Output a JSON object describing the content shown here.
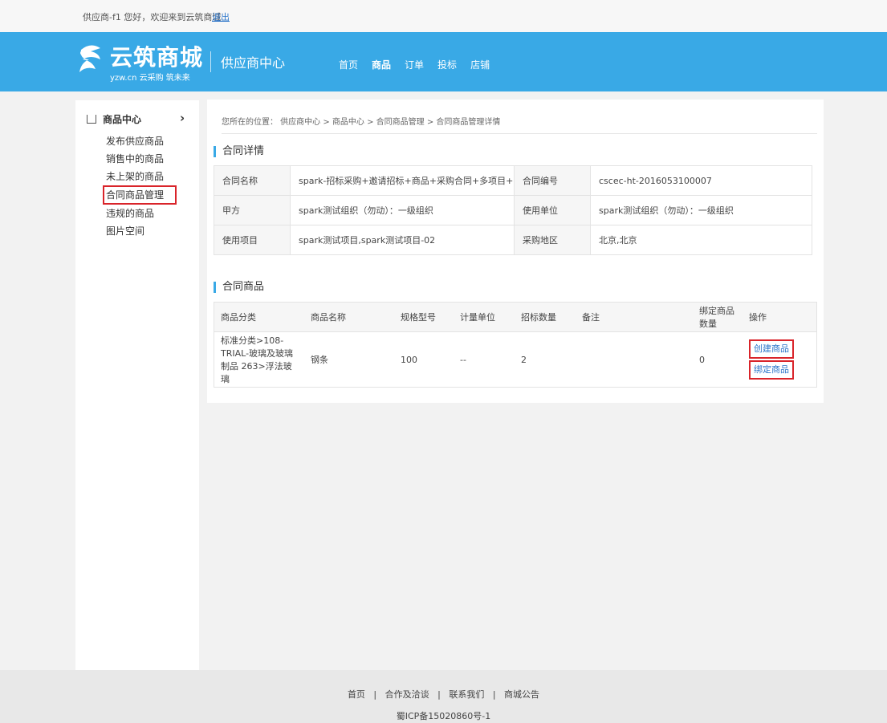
{
  "topbar": {
    "greeting": "供应商-f1 您好，欢迎来到云筑商城",
    "logout": "退出"
  },
  "header": {
    "logo_name": "云筑商城",
    "logo_sub": "yzw.cn 云采购 筑未来",
    "center_title": "供应商中心",
    "nav": [
      "首页",
      "商品",
      "订单",
      "投标",
      "店铺"
    ],
    "active_nav": "商品"
  },
  "sidebar": {
    "heading": "商品中心",
    "items": [
      "发布供应商品",
      "销售中的商品",
      "未上架的商品",
      "合同商品管理",
      "违规的商品",
      "图片空间"
    ],
    "selected": "合同商品管理"
  },
  "breadcrumb": "您所在的位置： 供应商中心 > 商品中心 > 合同商品管理 > 合同商品管理详情",
  "contract": {
    "title": "合同详情",
    "rows": [
      [
        "合同名称",
        "spark-招标采购+邀请招标+商品+采购合同+多项目+不按区划",
        "合同编号",
        "cscec-ht-2016053100007"
      ],
      [
        "甲方",
        "spark测试组织（勿动）：一级组织",
        "使用单位",
        "spark测试组织（勿动）：一级组织"
      ],
      [
        "使用项目",
        "spark测试项目,spark测试项目-02",
        "采购地区",
        "北京,北京"
      ]
    ]
  },
  "goods": {
    "title": "合同商品",
    "columns": [
      "商品分类",
      "商品名称",
      "规格型号",
      "计量单位",
      "招标数量",
      "备注",
      "绑定商品数量",
      "操作"
    ],
    "rows": [
      {
        "category": "标准分类>108-TRIAL-玻璃及玻璃制品 263>浮法玻璃",
        "name": "钢条",
        "spec": "100",
        "unit": "--",
        "qty": "2",
        "note": "",
        "bound": "0",
        "actions": [
          "创建商品",
          "绑定商品"
        ]
      }
    ]
  },
  "footer": {
    "links": [
      "首页",
      "合作及洽谈",
      "联系我们",
      "商城公告"
    ],
    "icp": "蜀ICP备15020860号-1"
  },
  "colors": {
    "header_bg": "#39a9e6",
    "highlight_border": "#d9242a",
    "link": "#2a74c9"
  }
}
